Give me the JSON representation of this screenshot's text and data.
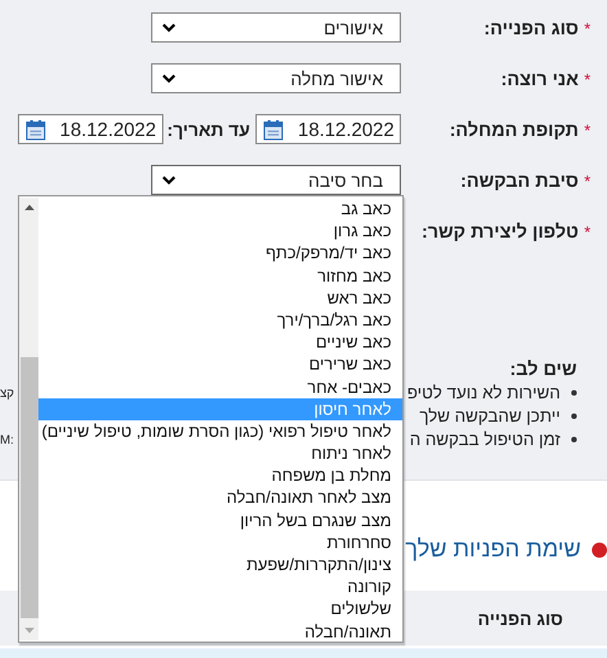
{
  "form": {
    "fields": [
      {
        "label": "סוג הפנייה:",
        "required_mark": "*",
        "kind": "select",
        "value": "אישורים",
        "expanded": false
      },
      {
        "label": "אני רוצה:",
        "required_mark": "*",
        "kind": "select",
        "value": "אישור מחלה",
        "expanded": false
      },
      {
        "label": "תקופת המחלה:",
        "required_mark": "*",
        "kind": "date_range",
        "from": "18.12.2022",
        "to_label": "עד תאריך:",
        "to": "18.12.2022"
      },
      {
        "label": "סיבת הבקשה:",
        "required_mark": "*",
        "kind": "select",
        "value": "בחר סיבה",
        "expanded": true
      },
      {
        "label": "טלפון ליצירת קשר:",
        "required_mark": "*",
        "kind": "phone"
      }
    ]
  },
  "dropdown": {
    "options": [
      {
        "label": "כאב גב",
        "selected": false
      },
      {
        "label": "כאב גרון",
        "selected": false
      },
      {
        "label": "כאב יד/מרפק/כתף",
        "selected": false
      },
      {
        "label": "כאב מחזור",
        "selected": false
      },
      {
        "label": "כאב ראש",
        "selected": false
      },
      {
        "label": "כאב רגל/ברך/ירך",
        "selected": false
      },
      {
        "label": "כאב שיניים",
        "selected": false
      },
      {
        "label": "כאב שרירים",
        "selected": false
      },
      {
        "label": "כאבים- אחר",
        "selected": false
      },
      {
        "label": "לאחר חיסון",
        "selected": true
      },
      {
        "label": "לאחר טיפול רפואי (כגון הסרת שומות, טיפול שיניים)",
        "selected": false
      },
      {
        "label": "לאחר ניתוח",
        "selected": false
      },
      {
        "label": "מחלת בן משפחה",
        "selected": false
      },
      {
        "label": "מצב לאחר תאונה/חבלה",
        "selected": false
      },
      {
        "label": "מצב שנגרם בשל הריון",
        "selected": false
      },
      {
        "label": "סחרחורת",
        "selected": false
      },
      {
        "label": "צינון/התקררות/שפעת",
        "selected": false
      },
      {
        "label": "קורונה",
        "selected": false
      },
      {
        "label": "שלשולים",
        "selected": false
      },
      {
        "label": "תאונה/חבלה",
        "selected": false
      }
    ]
  },
  "notice": {
    "title": "שים לב:",
    "items": [
      {
        "text": "השירות לא נועד לטיפ",
        "tail": "קצ"
      },
      {
        "text": "ייתכן שהבקשה שלך"
      },
      {
        "text": "זמן הטיפול בבקשה ה",
        "tail": "M:"
      }
    ]
  },
  "requests": {
    "title": "שימת הפניות שלך",
    "columns": [
      "סוג הפנייה"
    ]
  }
}
